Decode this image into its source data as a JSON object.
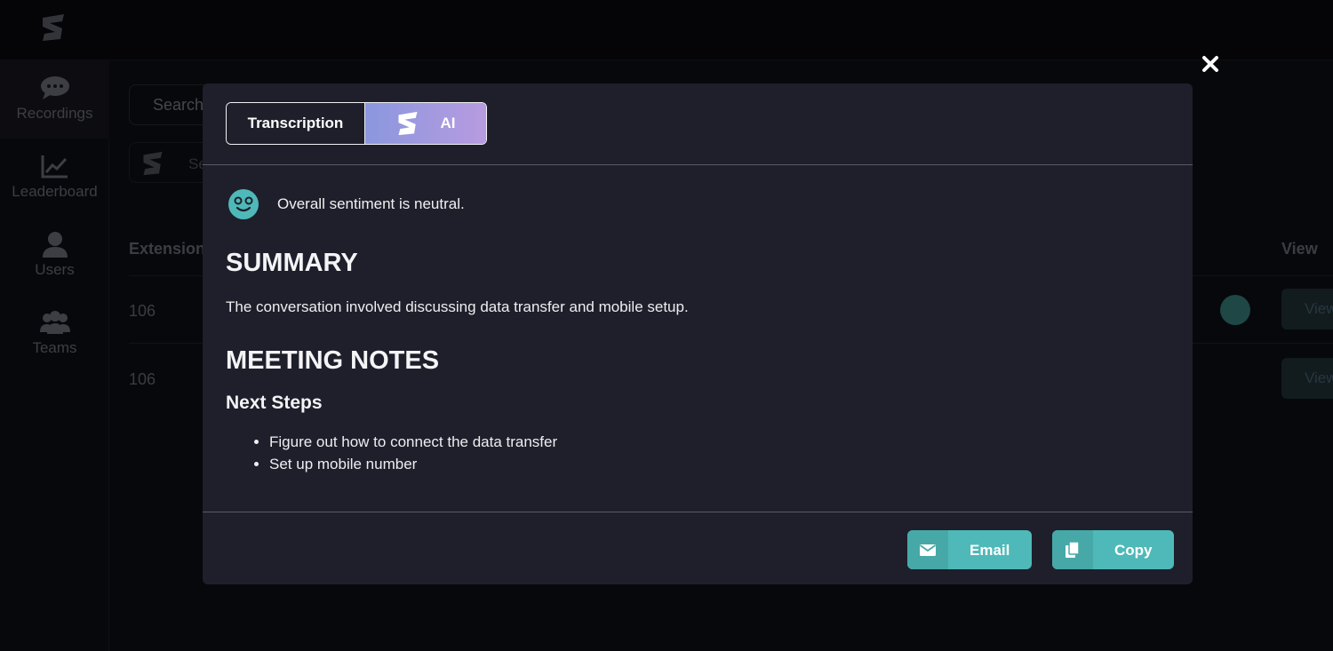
{
  "app": {
    "nav": [
      {
        "label": "Recordings",
        "icon": "chat-bubble-icon"
      },
      {
        "label": "Leaderboard",
        "icon": "chart-icon"
      },
      {
        "label": "Users",
        "icon": "user-icon"
      },
      {
        "label": "Teams",
        "icon": "team-icon"
      }
    ],
    "search": {
      "label": "Search"
    },
    "filter": {
      "label": "Se"
    },
    "table": {
      "headers": {
        "extension": "Extension",
        "view": "View"
      },
      "rows": [
        {
          "extension": "106",
          "view": "View"
        },
        {
          "extension": "106",
          "view": "View"
        }
      ]
    }
  },
  "modal": {
    "tabs": {
      "transcription": "Transcription",
      "ai": "AI"
    },
    "sentiment": "Overall sentiment is neutral.",
    "summary_heading": "SUMMARY",
    "summary_text": "The conversation involved discussing data transfer and mobile setup.",
    "notes_heading": "MEETING NOTES",
    "next_steps_heading": "Next Steps",
    "next_steps": [
      "Figure out how to connect the data transfer",
      "Set up mobile number"
    ],
    "buttons": {
      "email": "Email",
      "copy": "Copy"
    }
  },
  "colors": {
    "accent": "#4eb9b8",
    "ai_gradient_start": "#8a97de",
    "ai_gradient_end": "#b89be0",
    "modal_bg": "#1e1f2b",
    "page_bg": "#0c0d12"
  }
}
